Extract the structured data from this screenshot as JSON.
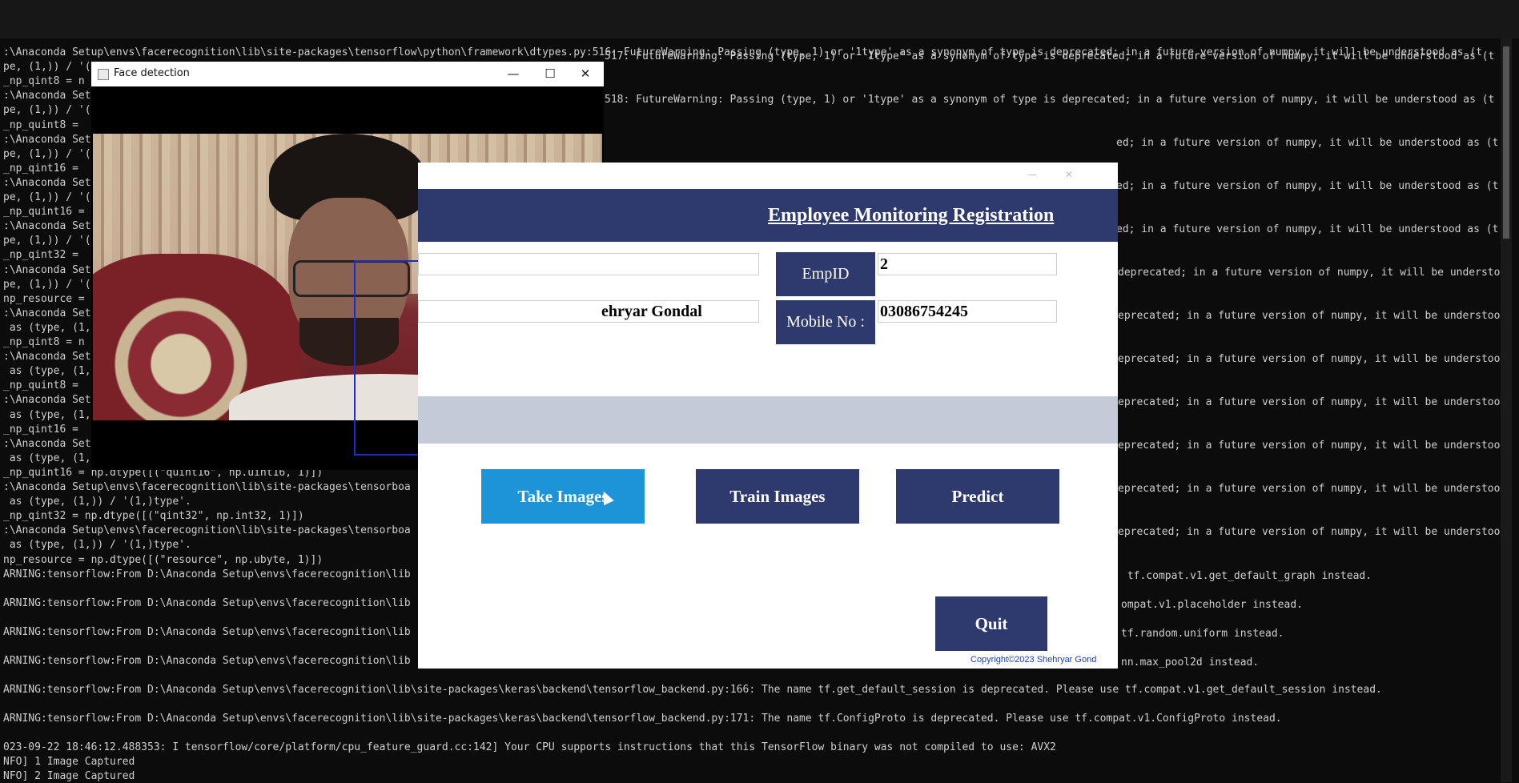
{
  "console": {
    "lines_left": [
      ":\\Anaconda Setup\\envs\\facerecognition\\lib\\site-packages\\tensorflow\\python\\framework\\dtypes.py:516: FutureWarning: Passing (type, 1) or '1type' as a synonym of type is deprecated; in a future version of numpy, it will be understood as (t",
      "pe, (1,)) / '(",
      "_np_qint8 = n",
      ":\\Anaconda Set",
      "pe, (1,)) / '(",
      "_np_quint8 =",
      ":\\Anaconda Set",
      "pe, (1,)) / '(",
      "_np_qint16 =",
      ":\\Anaconda Set",
      "pe, (1,)) / '(",
      "_np_quint16 =",
      ":\\Anaconda Set",
      "pe, (1,)) / '(",
      "_np_qint32 =",
      ":\\Anaconda Set",
      "pe, (1,)) / '(",
      "np_resource =",
      ":\\Anaconda Set",
      " as (type, (1,",
      "_np_qint8 = n",
      ":\\Anaconda Set",
      " as (type, (1,",
      "_np_quint8 =",
      ":\\Anaconda Set",
      " as (type, (1,",
      "_np_qint16 =",
      ":\\Anaconda Set",
      " as (type, (1,",
      "_np_quint16 = np.dtype([(\"quint16\", np.uint16, 1)])",
      ":\\Anaconda Setup\\envs\\facerecognition\\lib\\site-packages\\tensorboa",
      " as (type, (1,)) / '(1,)type'.",
      "_np_qint32 = np.dtype([(\"qint32\", np.int32, 1)])",
      ":\\Anaconda Setup\\envs\\facerecognition\\lib\\site-packages\\tensorboa",
      " as (type, (1,)) / '(1,)type'.",
      "np_resource = np.dtype([(\"resource\", np.ubyte, 1)])",
      "ARNING:tensorflow:From D:\\Anaconda Setup\\envs\\facerecognition\\lib",
      "",
      "ARNING:tensorflow:From D:\\Anaconda Setup\\envs\\facerecognition\\lib",
      "",
      "ARNING:tensorflow:From D:\\Anaconda Setup\\envs\\facerecognition\\lib",
      "",
      "ARNING:tensorflow:From D:\\Anaconda Setup\\envs\\facerecognition\\lib",
      "",
      "ARNING:tensorflow:From D:\\Anaconda Setup\\envs\\facerecognition\\lib\\site-packages\\keras\\backend\\tensorflow_backend.py:166: The name tf.get_default_session is deprecated. Please use tf.compat.v1.get_default_session instead.",
      "",
      "ARNING:tensorflow:From D:\\Anaconda Setup\\envs\\facerecognition\\lib\\site-packages\\keras\\backend\\tensorflow_backend.py:171: The name tf.ConfigProto is deprecated. Please use tf.compat.v1.ConfigProto instead.",
      "",
      "023-09-22 18:46:12.488353: I tensorflow/core/platform/cpu_feature_guard.cc:142] Your CPU supports instructions that this TensorFlow binary was not compiled to use: AVX2",
      "NFO] 1 Image Captured",
      "NFO] 2 Image Captured"
    ],
    "lines_right": [
      "517: FutureWarning: Passing (type, 1) or '1type' as a synonym of type is deprecated; in a future version of numpy, it will be understood as (t",
      "518: FutureWarning: Passing (type, 1) or '1type' as a synonym of type is deprecated; in a future version of numpy, it will be understood as (t",
      "ed; in a future version of numpy, it will be understood as (t",
      "ed; in a future version of numpy, it will be understood as (t",
      "ed; in a future version of numpy, it will be understood as (t",
      "deprecated; in a future version of numpy, it will be understoo",
      "eprecated; in a future version of numpy, it will be understoo",
      "eprecated; in a future version of numpy, it will be understoo",
      "eprecated; in a future version of numpy, it will be understoo",
      "eprecated; in a future version of numpy, it will be understoo",
      "eprecated; in a future version of numpy, it will be understoo",
      "eprecated; in a future version of numpy, it will be understoo",
      " tf.compat.v1.get_default_graph instead.",
      "ompat.v1.placeholder instead.",
      "tf.random.uniform instead.",
      "nn.max_pool2d instead."
    ]
  },
  "face_window": {
    "title": "Face detection",
    "minimize": "—",
    "maximize": "☐",
    "close": "✕"
  },
  "registration": {
    "heading": "Employee Monitoring Registration",
    "name_value": "ehryar Gondal",
    "empid_label": "EmpID",
    "empid_value": "2",
    "mobile_label": "Mobile No :",
    "mobile_value": "03086754245",
    "buttons": {
      "take_images": "Take Images",
      "train_images": "Train Images",
      "predict": "Predict",
      "quit": "Quit"
    },
    "copyright": "Copyright©2023 Shehryar Gond"
  },
  "colors": {
    "header_navy": "#2e3a6e",
    "active_button": "#1e94d8",
    "detection_box": "#1a2ccc"
  }
}
